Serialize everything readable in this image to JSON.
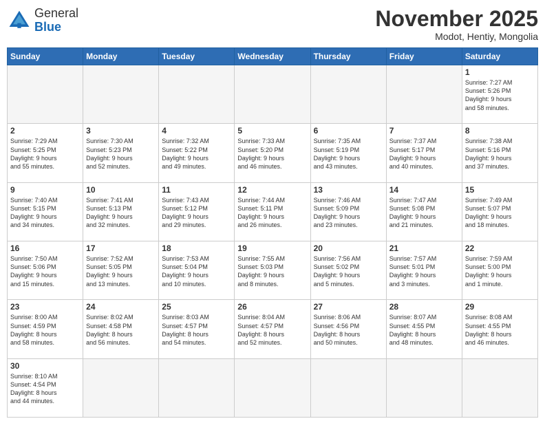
{
  "header": {
    "logo_general": "General",
    "logo_blue": "Blue",
    "month_title": "November 2025",
    "location": "Modot, Hentiy, Mongolia"
  },
  "weekdays": [
    "Sunday",
    "Monday",
    "Tuesday",
    "Wednesday",
    "Thursday",
    "Friday",
    "Saturday"
  ],
  "days": {
    "d1": {
      "num": "1",
      "sunrise": "7:27 AM",
      "sunset": "5:26 PM",
      "hours": "9",
      "minutes": "58"
    },
    "d2": {
      "num": "2",
      "sunrise": "7:29 AM",
      "sunset": "5:25 PM",
      "hours": "9",
      "minutes": "55"
    },
    "d3": {
      "num": "3",
      "sunrise": "7:30 AM",
      "sunset": "5:23 PM",
      "hours": "9",
      "minutes": "52"
    },
    "d4": {
      "num": "4",
      "sunrise": "7:32 AM",
      "sunset": "5:22 PM",
      "hours": "9",
      "minutes": "49"
    },
    "d5": {
      "num": "5",
      "sunrise": "7:33 AM",
      "sunset": "5:20 PM",
      "hours": "9",
      "minutes": "46"
    },
    "d6": {
      "num": "6",
      "sunrise": "7:35 AM",
      "sunset": "5:19 PM",
      "hours": "9",
      "minutes": "43"
    },
    "d7": {
      "num": "7",
      "sunrise": "7:37 AM",
      "sunset": "5:17 PM",
      "hours": "9",
      "minutes": "40"
    },
    "d8": {
      "num": "8",
      "sunrise": "7:38 AM",
      "sunset": "5:16 PM",
      "hours": "9",
      "minutes": "37"
    },
    "d9": {
      "num": "9",
      "sunrise": "7:40 AM",
      "sunset": "5:15 PM",
      "hours": "9",
      "minutes": "34"
    },
    "d10": {
      "num": "10",
      "sunrise": "7:41 AM",
      "sunset": "5:13 PM",
      "hours": "9",
      "minutes": "32"
    },
    "d11": {
      "num": "11",
      "sunrise": "7:43 AM",
      "sunset": "5:12 PM",
      "hours": "9",
      "minutes": "29"
    },
    "d12": {
      "num": "12",
      "sunrise": "7:44 AM",
      "sunset": "5:11 PM",
      "hours": "9",
      "minutes": "26"
    },
    "d13": {
      "num": "13",
      "sunrise": "7:46 AM",
      "sunset": "5:09 PM",
      "hours": "9",
      "minutes": "23"
    },
    "d14": {
      "num": "14",
      "sunrise": "7:47 AM",
      "sunset": "5:08 PM",
      "hours": "9",
      "minutes": "21"
    },
    "d15": {
      "num": "15",
      "sunrise": "7:49 AM",
      "sunset": "5:07 PM",
      "hours": "9",
      "minutes": "18"
    },
    "d16": {
      "num": "16",
      "sunrise": "7:50 AM",
      "sunset": "5:06 PM",
      "hours": "9",
      "minutes": "15"
    },
    "d17": {
      "num": "17",
      "sunrise": "7:52 AM",
      "sunset": "5:05 PM",
      "hours": "9",
      "minutes": "13"
    },
    "d18": {
      "num": "18",
      "sunrise": "7:53 AM",
      "sunset": "5:04 PM",
      "hours": "9",
      "minutes": "10"
    },
    "d19": {
      "num": "19",
      "sunrise": "7:55 AM",
      "sunset": "5:03 PM",
      "hours": "9",
      "minutes": "8"
    },
    "d20": {
      "num": "20",
      "sunrise": "7:56 AM",
      "sunset": "5:02 PM",
      "hours": "9",
      "minutes": "5"
    },
    "d21": {
      "num": "21",
      "sunrise": "7:57 AM",
      "sunset": "5:01 PM",
      "hours": "9",
      "minutes": "3"
    },
    "d22": {
      "num": "22",
      "sunrise": "7:59 AM",
      "sunset": "5:00 PM",
      "hours": "9",
      "minutes": "1"
    },
    "d23": {
      "num": "23",
      "sunrise": "8:00 AM",
      "sunset": "4:59 PM",
      "hours": "8",
      "minutes": "58"
    },
    "d24": {
      "num": "24",
      "sunrise": "8:02 AM",
      "sunset": "4:58 PM",
      "hours": "8",
      "minutes": "56"
    },
    "d25": {
      "num": "25",
      "sunrise": "8:03 AM",
      "sunset": "4:57 PM",
      "hours": "8",
      "minutes": "54"
    },
    "d26": {
      "num": "26",
      "sunrise": "8:04 AM",
      "sunset": "4:57 PM",
      "hours": "8",
      "minutes": "52"
    },
    "d27": {
      "num": "27",
      "sunrise": "8:06 AM",
      "sunset": "4:56 PM",
      "hours": "8",
      "minutes": "50"
    },
    "d28": {
      "num": "28",
      "sunrise": "8:07 AM",
      "sunset": "4:55 PM",
      "hours": "8",
      "minutes": "48"
    },
    "d29": {
      "num": "29",
      "sunrise": "8:08 AM",
      "sunset": "4:55 PM",
      "hours": "8",
      "minutes": "46"
    },
    "d30": {
      "num": "30",
      "sunrise": "8:10 AM",
      "sunset": "4:54 PM",
      "hours": "8",
      "minutes": "44"
    }
  }
}
